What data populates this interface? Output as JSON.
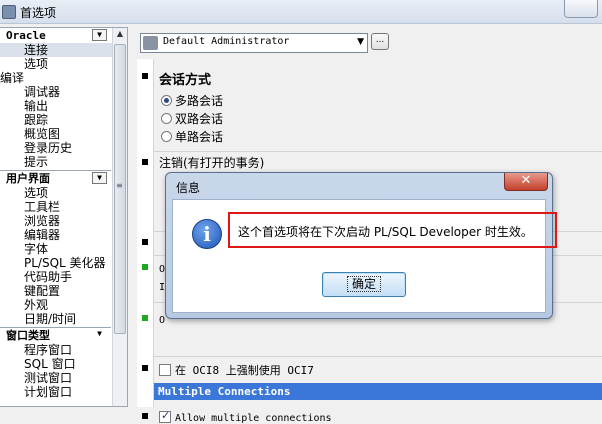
{
  "window": {
    "title": "首选项"
  },
  "sidebar": {
    "groups": [
      {
        "label": "Oracle",
        "items": [
          "连接",
          "选项"
        ]
      },
      {
        "label": "编译",
        "items": [
          "调试器",
          "输出",
          "跟踪",
          "概览图",
          "登录历史",
          "提示"
        ]
      },
      {
        "label": "用户界面",
        "items": [
          "选项",
          "工具栏",
          "浏览器",
          "编辑器",
          "字体",
          "PL/SQL 美化器",
          "代码助手",
          "键配置",
          "外观",
          "日期/时间"
        ]
      },
      {
        "label": "窗口类型",
        "items": [
          "程序窗口",
          "SQL 窗口",
          "测试窗口",
          "计划窗口"
        ]
      }
    ]
  },
  "toolbar": {
    "profile_value": "Default Administrator",
    "more_button": "..."
  },
  "session": {
    "title": "会话方式",
    "options": [
      "多路会话",
      "双路会话",
      "单路会话"
    ],
    "selected_index": 0
  },
  "logout": {
    "title": "注销(有打开的事务)"
  },
  "partial_rows": [
    "O",
    "I",
    "O"
  ],
  "oci8_checkbox": {
    "label": "在 OCI8 上强制使用 OCI7",
    "checked": false
  },
  "multiple_connections": {
    "header": "Multiple Connections",
    "allow_label": "Allow multiple connections",
    "checked": true
  },
  "dialog": {
    "title": "信息",
    "close": "✕",
    "message": "这个首选项将在下次启动 PL/SQL Developer 时生效。",
    "ok_label": "确定"
  }
}
